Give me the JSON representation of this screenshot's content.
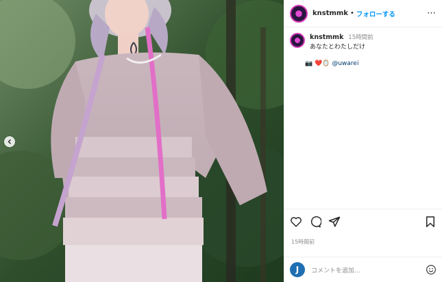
{
  "post": {
    "username": "knstmmk",
    "separator": "•",
    "follow_label": "フォローする",
    "more_label": "⋯",
    "caption_user": "knstmmk",
    "caption_time": "15時間前",
    "caption_text": "あなたとわたしだけ",
    "mention_prefix": "📷 ❤️🪞 ",
    "mention": "@uwarei",
    "post_time": "15時間前"
  },
  "comment_box": {
    "avatar_letter": "J",
    "placeholder": "コメントを追加..."
  },
  "icons": {
    "like": "heart-icon",
    "comment": "comment-icon",
    "share": "share-icon",
    "save": "bookmark-icon",
    "emoji": "emoji-icon",
    "carousel_prev": "chevron-left-icon",
    "more": "more-icon"
  },
  "colors": {
    "accent": "#0095f6",
    "mention": "#00376b",
    "muted": "#8e8e8e",
    "border": "#efefef"
  }
}
